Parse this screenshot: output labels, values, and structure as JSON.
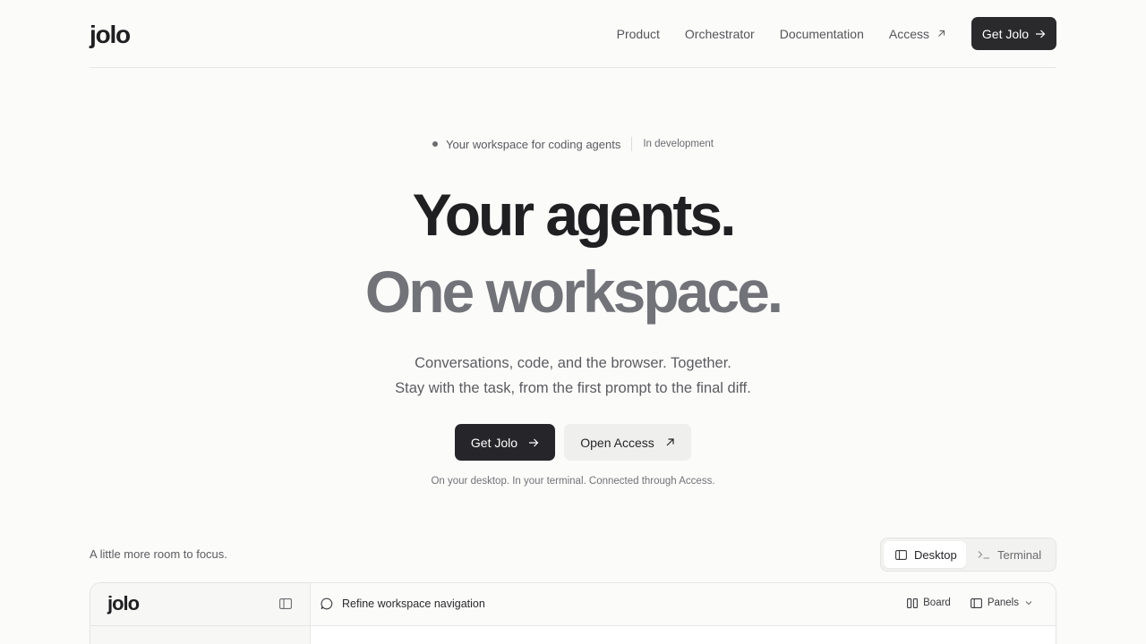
{
  "header": {
    "logo": "jolo",
    "nav": {
      "product": "Product",
      "orchestrator": "Orchestrator",
      "documentation": "Documentation",
      "access": "Access"
    },
    "cta": "Get Jolo"
  },
  "hero": {
    "pill_text": "Your workspace for coding agents",
    "pill_tag": "In development",
    "headline_1": "Your agents.",
    "headline_2": "One workspace.",
    "subtitle_1": "Conversations, code, and the browser. Together.",
    "subtitle_2": "Stay with the task, from the first prompt to the final diff.",
    "primary_cta": "Get Jolo",
    "secondary_cta": "Open Access",
    "note": "On your desktop. In your terminal. Connected through Access."
  },
  "preview": {
    "label": "A little more room to focus.",
    "tabs": {
      "desktop": "Desktop",
      "terminal": "Terminal"
    },
    "window": {
      "logo": "jolo",
      "title": "Refine workspace navigation",
      "board": "Board",
      "panels": "Panels"
    }
  },
  "colors": {
    "background": "#fbfbfa",
    "dark": "#26262a",
    "muted_heading": "#727279"
  }
}
